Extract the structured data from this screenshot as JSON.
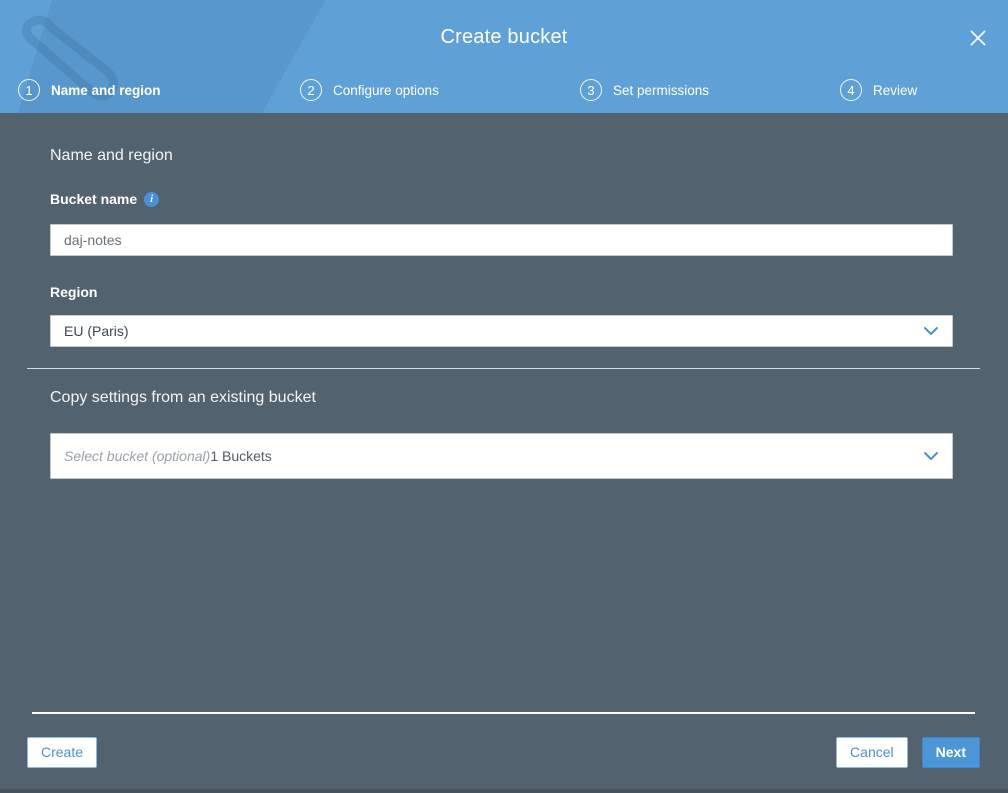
{
  "header": {
    "title": "Create bucket",
    "steps": [
      {
        "number": "1",
        "label": "Name and region"
      },
      {
        "number": "2",
        "label": "Configure options"
      },
      {
        "number": "3",
        "label": "Set permissions"
      },
      {
        "number": "4",
        "label": "Review"
      }
    ],
    "active_step": 1
  },
  "form": {
    "section_heading": "Name and region",
    "bucket_name": {
      "label": "Bucket name",
      "info_icon": "i",
      "value": "daj-notes"
    },
    "region": {
      "label": "Region",
      "selected_value": "EU (Paris)"
    },
    "copy_settings": {
      "heading": "Copy settings from an existing bucket",
      "placeholder": "Select bucket (optional)",
      "bucket_count": "1 Buckets"
    }
  },
  "footer": {
    "create_label": "Create",
    "cancel_label": "Cancel",
    "next_label": "Next"
  },
  "colors": {
    "header_blue": "#5fa0d6",
    "body_slate": "#53626f",
    "accent_blue": "#4a90d9",
    "primary_button_blue": "#4c96d7"
  }
}
